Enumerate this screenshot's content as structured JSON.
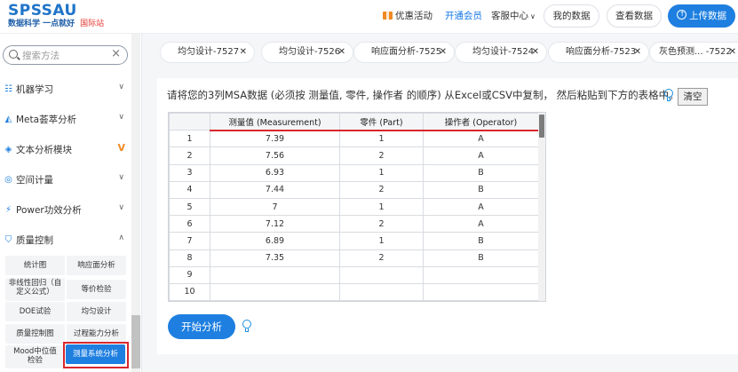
{
  "header": {
    "logo_main": "SPSSAU",
    "logo_sub": "数据科学 一点就好",
    "logo_intl": "国际站",
    "promo": "优惠活动",
    "member": "开通会员",
    "service": "客服中心",
    "my_data": "我的数据",
    "view_data": "查看数据",
    "upload": "上传数据",
    "accent_color": "#1e7fe0"
  },
  "sidebar": {
    "search_placeholder": "搜索方法",
    "items": [
      {
        "label": "机器学习",
        "icon": "machine-learning-icon"
      },
      {
        "label": "Meta荟萃分析",
        "icon": "meta-analysis-icon"
      },
      {
        "label": "文本分析模块",
        "icon": "text-analysis-icon",
        "badge": "V"
      },
      {
        "label": "空间计量",
        "icon": "spatial-icon"
      },
      {
        "label": "Power功效分析",
        "icon": "power-icon"
      },
      {
        "label": "质量控制",
        "icon": "quality-control-icon"
      }
    ],
    "sub_items": [
      "统计图",
      "响应面分析",
      "非线性回归（自定义公式）",
      "等价检验",
      "DOE试验",
      "均匀设计",
      "质量控制图",
      "过程能力分析",
      "Mood中位值检验",
      "测量系统分析"
    ],
    "active_sub_item": "测量系统分析"
  },
  "tabs": [
    {
      "label": "均匀设计-7527"
    },
    {
      "label": "均匀设计-7526"
    },
    {
      "label": "响应面分析-7525"
    },
    {
      "label": "均匀设计-7524"
    },
    {
      "label": "响应面分析-7523"
    },
    {
      "label": "灰色预测... -7522"
    }
  ],
  "main": {
    "instruction": "请将您的3列MSA数据 (必须按 测量值, 零件, 操作者 的顺序) 从Excel或CSV中复制， 然后粘贴到下方的表格中。",
    "clear_label": "清空",
    "start_label": "开始分析",
    "table": {
      "headers": [
        "测量值 (Measurement)",
        "零件 (Part)",
        "操作者 (Operator)"
      ],
      "rows": [
        {
          "n": "1",
          "m": "7.39",
          "p": "1",
          "o": "A"
        },
        {
          "n": "2",
          "m": "7.56",
          "p": "2",
          "o": "A"
        },
        {
          "n": "3",
          "m": "6.93",
          "p": "1",
          "o": "B"
        },
        {
          "n": "4",
          "m": "7.44",
          "p": "2",
          "o": "B"
        },
        {
          "n": "5",
          "m": "7",
          "p": "1",
          "o": "A"
        },
        {
          "n": "6",
          "m": "7.12",
          "p": "2",
          "o": "A"
        },
        {
          "n": "7",
          "m": "6.89",
          "p": "1",
          "o": "B"
        },
        {
          "n": "8",
          "m": "7.35",
          "p": "2",
          "o": "B"
        },
        {
          "n": "9",
          "m": "",
          "p": "",
          "o": ""
        },
        {
          "n": "10",
          "m": "",
          "p": "",
          "o": ""
        }
      ]
    }
  }
}
